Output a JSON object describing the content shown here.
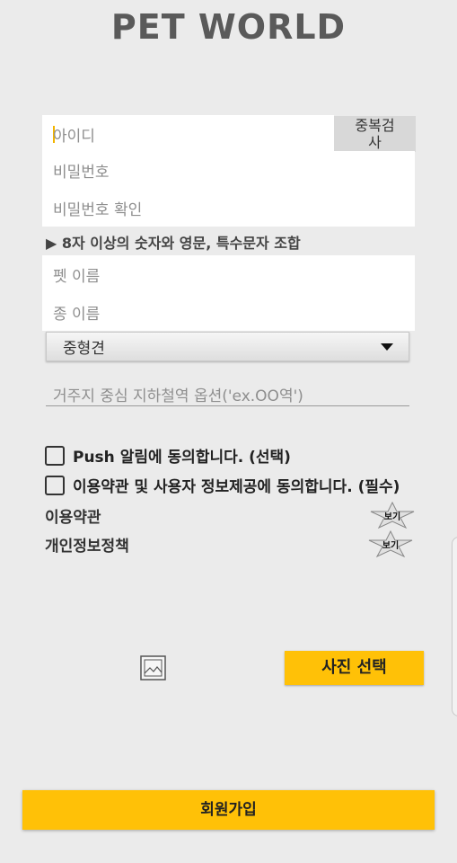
{
  "app": {
    "title": "PET WORLD"
  },
  "form": {
    "id_placeholder": "아이디",
    "dup_check_label": "중복검\n사",
    "password_placeholder": "비밀번호",
    "password_confirm_placeholder": "비밀번호 확인",
    "password_hint": "▶ 8자 이상의 숫자와 영문, 특수문자 조합",
    "pet_name_placeholder": "펫 이름",
    "breed_placeholder": "종 이름",
    "region_selected": "중형견",
    "subway_placeholder": "거주지 중심 지하철역 옵션('ex.OO역')"
  },
  "agreements": {
    "push_label": "Push 알림에 동의합니다. (선택)",
    "terms_label": "이용약관 및 사용자 정보제공에 동의합니다. (필수)"
  },
  "links": {
    "terms_label": "이용약관",
    "privacy_label": "개인정보정책",
    "view_label": "보기"
  },
  "photo": {
    "icon": "image-icon",
    "select_label": "사진 선택"
  },
  "actions": {
    "signup_label": "회원가입"
  },
  "colors": {
    "accent": "#ffc107",
    "background": "#ebebeb",
    "title": "#5a5a5a",
    "cursor": "#f2b400"
  }
}
